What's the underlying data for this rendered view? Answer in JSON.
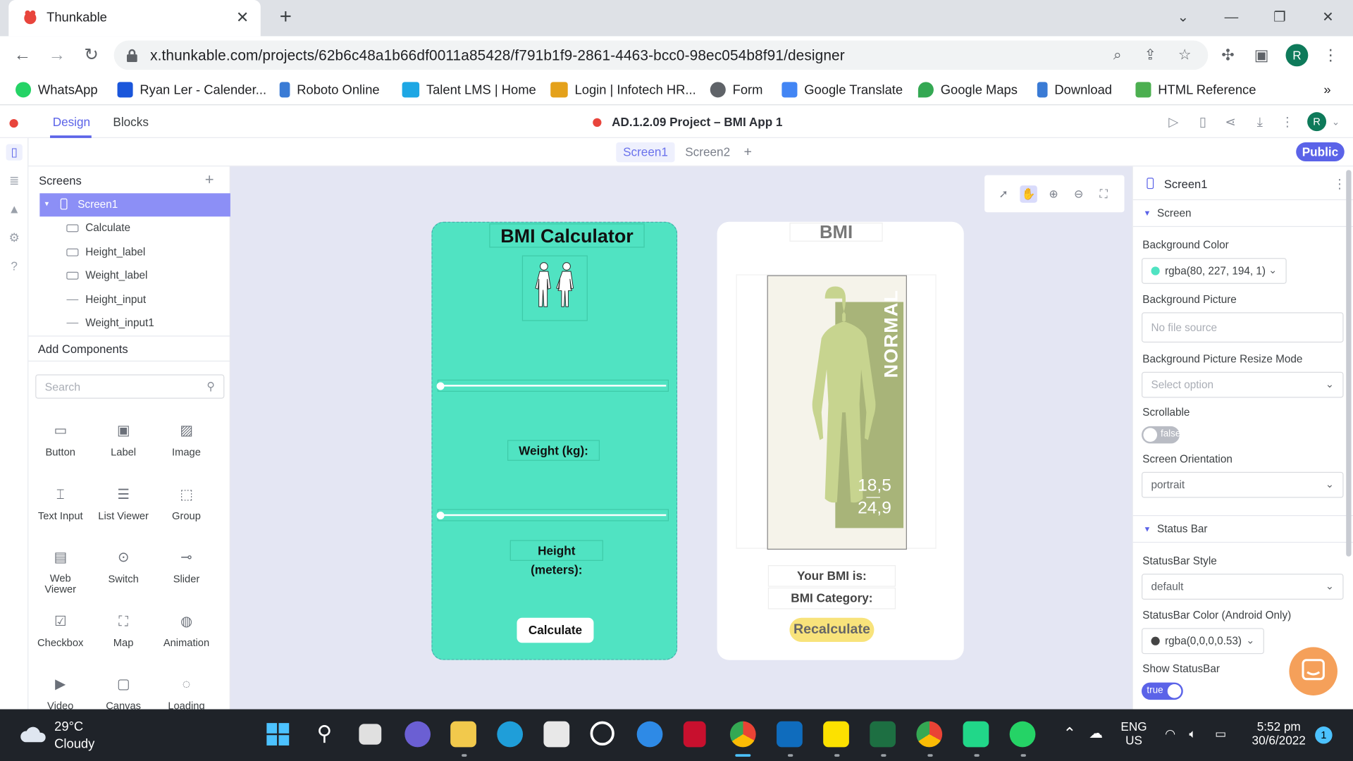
{
  "browser": {
    "tab_title": "Thunkable",
    "url": "x.thunkable.com/projects/62b6c48a1b66df0011a85428/f791b1f9-2861-4463-bcc0-98ec054b8f91/designer",
    "profile_initial": "R",
    "bookmarks": [
      {
        "label": "WhatsApp",
        "color": "#25d366"
      },
      {
        "label": "Ryan Ler - Calender...",
        "color": "#1a56db"
      },
      {
        "label": "Roboto Online",
        "color": "#3a7bd5"
      },
      {
        "label": "Talent LMS | Home",
        "color": "#1ea7e4"
      },
      {
        "label": "Login | Infotech HR...",
        "color": "#e4a11b"
      },
      {
        "label": "Form",
        "color": "#5f6368"
      },
      {
        "label": "Google Translate",
        "color": "#4285f4"
      },
      {
        "label": "Google Maps",
        "color": "#34a853"
      },
      {
        "label": "Download",
        "color": "#3a7bd5"
      },
      {
        "label": "HTML Reference",
        "color": "#4caf50"
      }
    ],
    "more_bookmarks": "»"
  },
  "app": {
    "tabs": {
      "design": "Design",
      "blocks": "Blocks"
    },
    "project_title": "AD.1.2.09 Project – BMI App 1",
    "user_initial": "R",
    "screen_tabs": [
      "Screen1",
      "Screen2"
    ],
    "add_screen": "+",
    "public_label": "Public",
    "accent": "#5b63e8"
  },
  "left_panel": {
    "screens_heading": "Screens",
    "tree": {
      "selected": "Screen1",
      "items": [
        "Calculate",
        "Height_label",
        "Weight_label",
        "Height_input",
        "Weight_input1"
      ]
    },
    "add_components": "Add Components",
    "search_placeholder": "Search",
    "components": [
      "Button",
      "Label",
      "Image",
      "Text Input",
      "List Viewer",
      "Group",
      "Web Viewer",
      "Switch",
      "Slider",
      "Checkbox",
      "Map",
      "Animation",
      "Video",
      "Canvas",
      "Loading"
    ]
  },
  "screen1": {
    "title": "BMI Calculator",
    "weight_label": "Weight (kg):",
    "height_label": "Height (meters):",
    "button": "Calculate",
    "bg_color": "#50e3c2"
  },
  "screen2": {
    "title": "BMI",
    "image_text_vertical": "NORMAL",
    "image_range_top": "18,5",
    "image_range_bottom": "24,9",
    "your_bmi": "Your BMI is:",
    "bmi_category": "BMI Category:",
    "button": "Recalculate"
  },
  "right_panel": {
    "title": "Screen1",
    "section_screen": "Screen",
    "bg_color_label": "Background Color",
    "bg_color_value": "rgba(80, 227, 194, 1)",
    "bg_picture_label": "Background Picture",
    "bg_picture_placeholder": "No file source",
    "resize_mode_label": "Background Picture Resize Mode",
    "resize_mode_placeholder": "Select option",
    "scrollable_label": "Scrollable",
    "scrollable_value": "false",
    "orientation_label": "Screen Orientation",
    "orientation_value": "portrait",
    "section_status": "Status Bar",
    "statusbar_style_label": "StatusBar Style",
    "statusbar_style_value": "default",
    "statusbar_color_label": "StatusBar Color (Android Only)",
    "statusbar_color_value": "rgba(0,0,0,0.53)",
    "show_statusbar_label": "Show StatusBar",
    "show_statusbar_value": "true"
  },
  "taskbar": {
    "temperature": "29°C",
    "weather": "Cloudy",
    "lang_top": "ENG",
    "lang_bottom": "US",
    "time": "5:52 pm",
    "date": "30/6/2022",
    "notification_count": "1"
  }
}
